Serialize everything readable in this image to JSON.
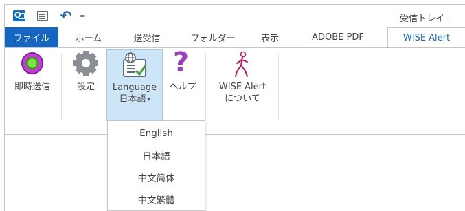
{
  "window": {
    "title": "受信トレイ -"
  },
  "quick_access": {
    "app_icon": "outlook-icon",
    "send_receive_icon": "send-receive-all-icon",
    "undo_icon": "undo-icon",
    "undo_glyph": "↶",
    "customize_icon": "customize-qat-icon",
    "customize_glyph": "="
  },
  "tabs": [
    {
      "label": "ファイル",
      "state": "file"
    },
    {
      "label": "ホーム",
      "state": "normal"
    },
    {
      "label": "送受信",
      "state": "normal"
    },
    {
      "label": "フォルダー",
      "state": "normal"
    },
    {
      "label": "表示",
      "state": "normal"
    },
    {
      "label": "ADOBE PDF",
      "state": "normal"
    },
    {
      "label": "WISE Alert",
      "state": "active"
    }
  ],
  "ribbon": {
    "send_now": {
      "label": "即時送信",
      "icon": "send-now-icon"
    },
    "settings": {
      "label": "設定",
      "icon": "gear-icon"
    },
    "language": {
      "label_line1": "Language",
      "label_line2": "日本語",
      "caret": "▾",
      "icon": "language-icon"
    },
    "help": {
      "label": "ヘルプ",
      "icon": "help-icon",
      "glyph": "?"
    },
    "about": {
      "label_line1": "WISE Alert",
      "label_line2": "について",
      "icon": "walking-person-icon"
    }
  },
  "language_menu": {
    "options": [
      "English",
      "日本語",
      "中文简体",
      "中文繁體"
    ],
    "selected": "日本語"
  },
  "colors": {
    "file_tab": "#1665c1",
    "active_tab_text": "#1665c1",
    "selected_button_bg": "#cde6f7",
    "help_icon": "#9b3fc1"
  }
}
